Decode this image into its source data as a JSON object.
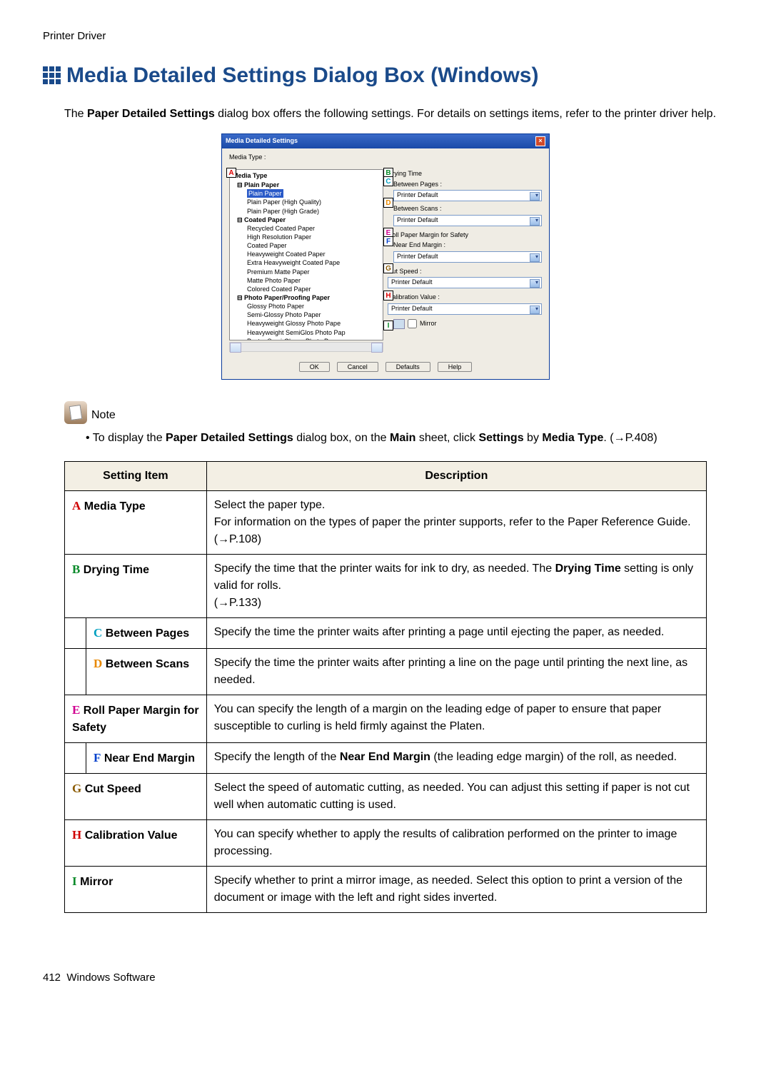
{
  "header": {
    "section": "Printer Driver"
  },
  "title": "Media Detailed Settings Dialog Box (Windows)",
  "intro": {
    "prefix": "The ",
    "bold": "Paper Detailed Settings",
    "rest": " dialog box offers the following settings. For details on settings items, refer to the printer driver help."
  },
  "note": {
    "label": "Note",
    "text_prefix": "To display the ",
    "bold1": "Paper Detailed Settings",
    "mid1": " dialog box, on the ",
    "bold2": "Main",
    "mid2": " sheet, click ",
    "bold3": "Settings",
    "mid3": " by ",
    "bold4": "Media Type",
    "suffix": ". (→P.408)"
  },
  "dialog": {
    "title": "Media Detailed Settings",
    "media_type_label": "Media Type :",
    "tree": {
      "root": "Media Type",
      "groups": [
        {
          "name": "Plain Paper",
          "items": [
            "Plain Paper",
            "Plain Paper (High Quality)",
            "Plain Paper (High Grade)"
          ]
        },
        {
          "name": "Coated Paper",
          "items": [
            "Recycled Coated Paper",
            "High Resolution Paper",
            "Coated Paper",
            "Heavyweight Coated Paper",
            "Extra Heavyweight Coated Pape",
            "Premium Matte Paper",
            "Matte Photo Paper",
            "Colored Coated Paper"
          ]
        },
        {
          "name": "Photo Paper/Proofing Paper",
          "items": [
            "Glossy Photo Paper",
            "Semi-Glossy Photo Paper",
            "Heavyweight Glossy Photo Pape",
            "Heavyweight SemiGlos Photo Pap",
            "Poster Semi-Glossy Photo Paper"
          ]
        }
      ],
      "selected": "Plain Paper"
    },
    "right": {
      "drying_time": "Drying Time",
      "between_pages": "Between Pages :",
      "between_scans": "Between Scans :",
      "roll_margin": "Roll Paper Margin for Safety",
      "near_end": "Near End Margin :",
      "cut_speed": "Cut Speed :",
      "calibration": "Calibration Value :",
      "mirror": "Mirror",
      "default_value": "Printer Default"
    },
    "buttons": {
      "ok": "OK",
      "cancel": "Cancel",
      "defaults": "Defaults",
      "help": "Help"
    }
  },
  "markers": {
    "A": "A",
    "B": "B",
    "C": "C",
    "D": "D",
    "E": "E",
    "F": "F",
    "G": "G",
    "H": "H",
    "I": "I"
  },
  "table": {
    "head": {
      "setting": "Setting Item",
      "desc": "Description"
    },
    "rows": {
      "A": {
        "label": "Media Type",
        "desc": "Select the paper type.\nFor information on the types of paper the printer supports, refer to the Paper Reference Guide. (→P.108)"
      },
      "B": {
        "label": "Drying Time",
        "desc_pre": "Specify the time that the printer waits for ink to dry, as needed. The ",
        "desc_bold": "Drying Time",
        "desc_post": " setting is only valid for rolls.\n(→P.133)"
      },
      "C": {
        "label": "Between Pages",
        "desc": "Specify the time the printer waits after printing a page until ejecting the paper, as needed."
      },
      "D": {
        "label": "Between Scans",
        "desc": "Specify the time the printer waits after printing a line on the page until printing the next line, as needed."
      },
      "E": {
        "label": "Roll Paper Margin for Safety",
        "desc": "You can specify the length of a margin on the leading edge of paper to ensure that paper susceptible to curling is held firmly against the Platen."
      },
      "F": {
        "label": "Near End Margin",
        "desc_pre": "Specify the length of the ",
        "desc_bold": "Near End Margin",
        "desc_post": " (the leading edge margin) of the roll, as needed."
      },
      "G": {
        "label": "Cut Speed",
        "desc": "Select the speed of automatic cutting, as needed. You can adjust this setting if paper is not cut well when automatic cutting is used."
      },
      "H": {
        "label": "Calibration Value",
        "desc": "You can specify whether to apply the results of calibration performed on the printer to image processing."
      },
      "I": {
        "label": "Mirror",
        "desc": "Specify whether to print a mirror image, as needed. Select this option to print a version of the document or image with the left and right sides inverted."
      }
    }
  },
  "footer": {
    "page": "412",
    "label": "Windows Software"
  }
}
